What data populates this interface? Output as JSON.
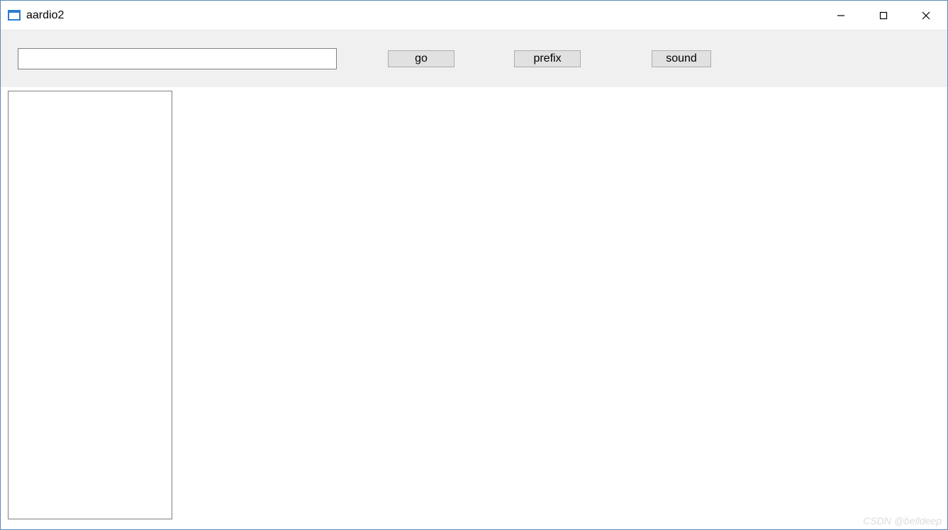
{
  "window": {
    "title": "aardio2"
  },
  "toolbar": {
    "input_value": "",
    "go_label": "go",
    "prefix_label": "prefix",
    "sound_label": "sound"
  },
  "watermark": "CSDN @belldeep"
}
